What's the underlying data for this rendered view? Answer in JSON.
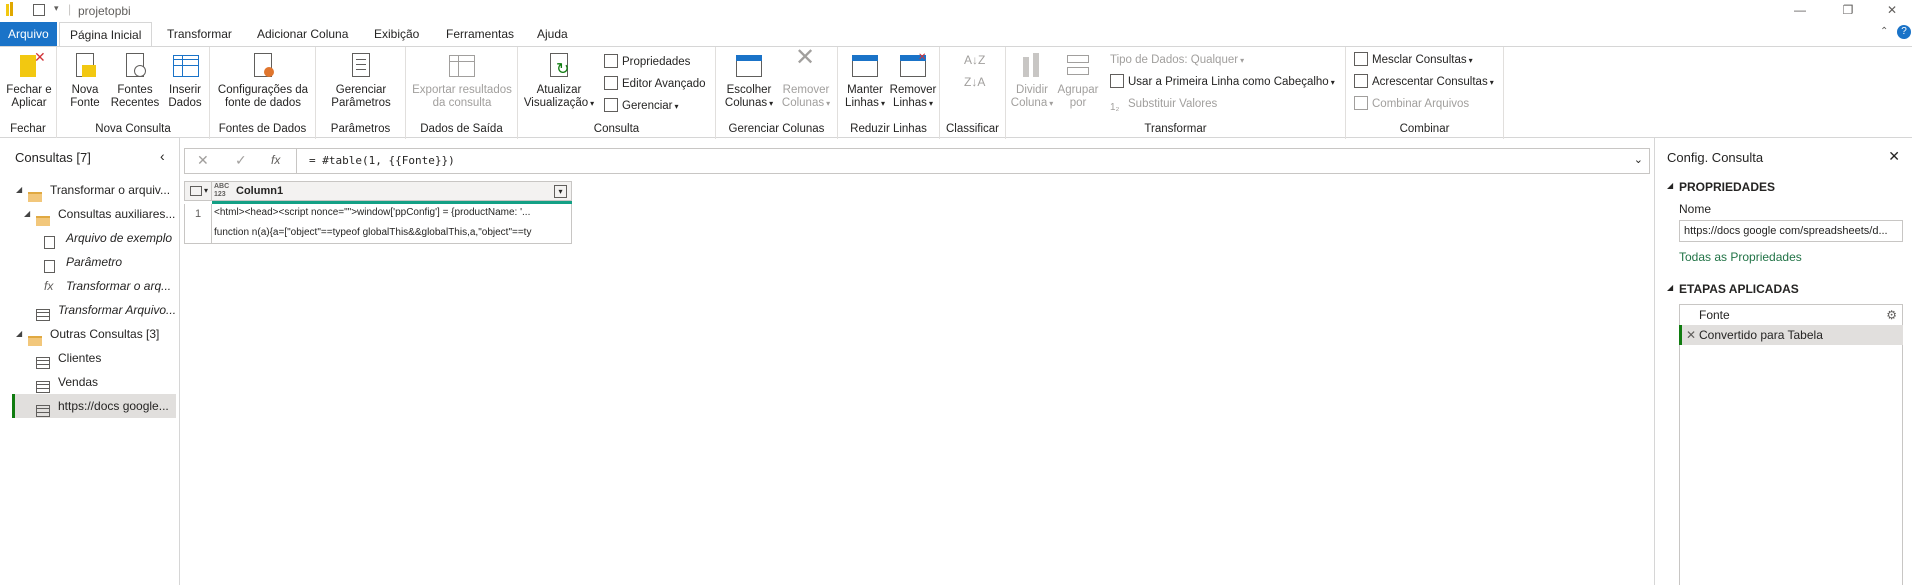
{
  "window": {
    "title": "projetopbi",
    "minimize": "—",
    "restore": "❐",
    "close": "✕"
  },
  "tabs": [
    {
      "label": "Arquivo"
    },
    {
      "label": "Página Inicial"
    },
    {
      "label": "Transformar"
    },
    {
      "label": "Adicionar Coluna"
    },
    {
      "label": "Exibição"
    },
    {
      "label": "Ferramentas"
    },
    {
      "label": "Ajuda"
    }
  ],
  "ribbon": {
    "fechar": {
      "label": "Fechar",
      "btn": "Fechar e\nAplicar"
    },
    "nova_consulta": {
      "label": "Nova Consulta",
      "nova_fonte": "Nova\nFonte",
      "fontes_recentes": "Fontes\nRecentes",
      "inserir_dados": "Inserir\nDados"
    },
    "fontes_dados": {
      "label": "Fontes de Dados",
      "config": "Configurações da\nfonte de dados"
    },
    "parametros": {
      "label": "Parâmetros",
      "gerenciar": "Gerenciar\nParâmetros"
    },
    "dados_saida": {
      "label": "Dados de Saída",
      "exportar": "Exportar resultados\nda consulta"
    },
    "consulta": {
      "label": "Consulta",
      "atualizar": "Atualizar\nVisualização",
      "propriedades": "Propriedades",
      "editor": "Editor Avançado",
      "gerenciar": "Gerenciar"
    },
    "gerenciar_colunas": {
      "label": "Gerenciar Colunas",
      "escolher": "Escolher\nColunas",
      "remover": "Remover\nColunas"
    },
    "reduzir_linhas": {
      "label": "Reduzir Linhas",
      "manter": "Manter\nLinhas",
      "remover": "Remover\nLinhas"
    },
    "classificar": {
      "label": "Classificar"
    },
    "transformar": {
      "label": "Transformar",
      "dividir": "Dividir\nColuna",
      "agrupar": "Agrupar\npor",
      "tipo": "Tipo de Dados: Qualquer",
      "primeira_linha": "Usar a Primeira Linha como Cabeçalho",
      "substituir": "Substituir Valores"
    },
    "combinar": {
      "label": "Combinar",
      "mesclar": "Mesclar Consultas",
      "acrescentar": "Acrescentar Consultas",
      "combinar_arquivos": "Combinar Arquivos"
    }
  },
  "queries_pane": {
    "title": "Consultas [7]",
    "items": [
      {
        "label": "Transformar o arquiv..."
      },
      {
        "label": "Consultas auxiliares..."
      },
      {
        "label": "Arquivo de exemplo"
      },
      {
        "label": "Parâmetro"
      },
      {
        "label": "Transformar o arq..."
      },
      {
        "label": "Transformar Arquivo..."
      },
      {
        "label": "Outras Consultas [3]"
      },
      {
        "label": "Clientes"
      },
      {
        "label": "Vendas"
      },
      {
        "label": "https://docs google..."
      }
    ]
  },
  "formula_bar": {
    "fx": "fx",
    "formula": "= #table(1, {{Fonte}})"
  },
  "grid": {
    "type_icon": "ABC\n123",
    "column": "Column1",
    "rows": [
      {
        "num": "1",
        "line1": "<html><head><script nonce=\"\">window['ppConfig'] = {productName: '...",
        "line2": "function n(a){a=[\"object\"==typeof globalThis&&globalThis,a,\"object\"==ty"
      }
    ]
  },
  "settings_pane": {
    "title": "Config. Consulta",
    "propriedades": "PROPRIEDADES",
    "nome_label": "Nome",
    "nome_value": "https://docs google com/spreadsheets/d...",
    "todas": "Todas as Propriedades",
    "etapas": "ETAPAS APLICADAS",
    "steps": [
      {
        "label": "Fonte"
      },
      {
        "label": "Convertido para Tabela"
      }
    ]
  }
}
